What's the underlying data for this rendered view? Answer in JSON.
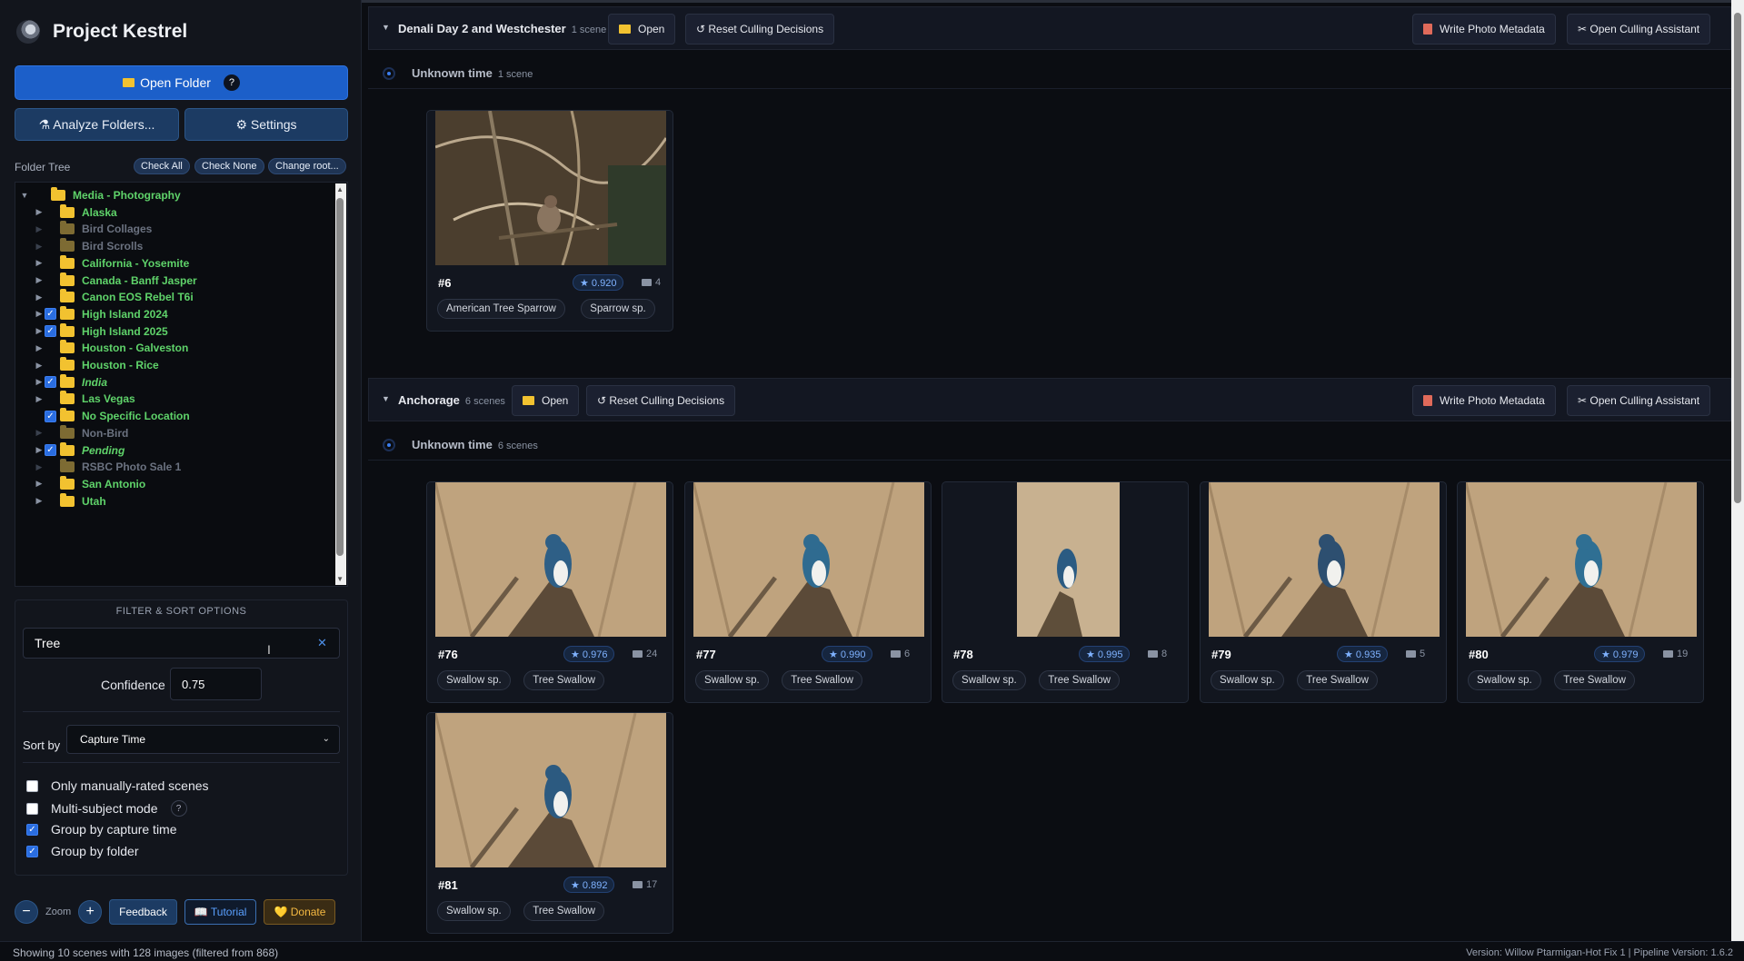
{
  "app": {
    "title": "Project Kestrel"
  },
  "sidebar": {
    "open_folder": "Open Folder",
    "help": "?",
    "analyze": "⚗ Analyze Folders...",
    "settings": "⚙ Settings",
    "tree_label": "Folder Tree",
    "check_all": "Check All",
    "check_none": "Check None",
    "change_root": "Change root..."
  },
  "tree": [
    {
      "name": "Media - Photography",
      "state": "open",
      "checked": false,
      "dim": false,
      "italic": false
    },
    {
      "name": "Alaska",
      "checked": false,
      "dim": false,
      "italic": false
    },
    {
      "name": "Bird Collages",
      "checked": false,
      "dim": true,
      "italic": false
    },
    {
      "name": "Bird Scrolls",
      "checked": false,
      "dim": true,
      "italic": false
    },
    {
      "name": "California - Yosemite",
      "checked": false,
      "dim": false,
      "italic": false
    },
    {
      "name": "Canada - Banff Jasper",
      "checked": false,
      "dim": false,
      "italic": false
    },
    {
      "name": "Canon EOS Rebel T6i",
      "checked": false,
      "dim": false,
      "italic": false
    },
    {
      "name": "High Island 2024",
      "checked": true,
      "dim": false,
      "italic": false
    },
    {
      "name": "High Island 2025",
      "checked": true,
      "dim": false,
      "italic": false
    },
    {
      "name": "Houston - Galveston",
      "checked": false,
      "dim": false,
      "italic": false
    },
    {
      "name": "Houston - Rice",
      "checked": false,
      "dim": false,
      "italic": false
    },
    {
      "name": "India",
      "checked": true,
      "dim": false,
      "italic": true
    },
    {
      "name": "Las Vegas",
      "checked": false,
      "dim": false,
      "italic": false
    },
    {
      "name": "No Specific Location",
      "checked": true,
      "dim": false,
      "italic": false
    },
    {
      "name": "Non-Bird",
      "checked": false,
      "dim": true,
      "italic": false
    },
    {
      "name": "Pending",
      "checked": true,
      "dim": false,
      "italic": true
    },
    {
      "name": "RSBC Photo Sale 1",
      "checked": false,
      "dim": true,
      "italic": false
    },
    {
      "name": "San Antonio",
      "checked": false,
      "dim": false,
      "italic": false
    },
    {
      "name": "Utah",
      "checked": false,
      "dim": false,
      "italic": false
    }
  ],
  "filter": {
    "title": "FILTER & SORT OPTIONS",
    "search_value": "Tree",
    "clear": "✕",
    "confidence_label": "Confidence",
    "confidence_value": "0.75",
    "sort_label": "Sort by",
    "sort_value": "Capture Time",
    "options": [
      {
        "label": "Only manually-rated scenes",
        "checked": false
      },
      {
        "label": "Multi-subject mode",
        "checked": false
      },
      {
        "label": "Group by capture time",
        "checked": true
      },
      {
        "label": "Group by folder",
        "checked": true
      }
    ],
    "multi_help": "?"
  },
  "bottom": {
    "zoom_minus": "−",
    "zoom_label": "Zoom",
    "zoom_plus": "+",
    "feedback": "Feedback",
    "tutorial": "📖 Tutorial",
    "donate": "💛 Donate"
  },
  "status": {
    "left": "Showing 10 scenes with 128 images (filtered from 868)",
    "right": "Version: Willow Ptarmigan-Hot Fix 1 | Pipeline Version: 1.6.2"
  },
  "groups": [
    {
      "title": "Denali Day 2 and Westchester",
      "count": "1 scene",
      "open": "Open",
      "reset": "↺ Reset Culling Decisions",
      "write": "Write Photo Metadata",
      "assistant": "✂ Open Culling Assistant",
      "time_label": "Unknown time",
      "time_count": "1 scene"
    },
    {
      "title": "Anchorage",
      "count": "6 scenes",
      "open": "Open",
      "reset": "↺ Reset Culling Decisions",
      "write": "Write Photo Metadata",
      "assistant": "✂ Open Culling Assistant",
      "time_label": "Unknown time",
      "time_count": "6 scenes"
    }
  ],
  "cards": [
    {
      "num": "#6",
      "conf": "★ 0.920",
      "count": "4",
      "tags": [
        "American Tree Sparrow",
        "Sparrow sp."
      ],
      "bird_color": "#8a7560"
    },
    {
      "num": "#76",
      "conf": "★ 0.976",
      "count": "24",
      "tags": [
        "Swallow sp.",
        "Tree Swallow"
      ],
      "bird_color": "#2e5f86"
    },
    {
      "num": "#77",
      "conf": "★ 0.990",
      "count": "6",
      "tags": [
        "Swallow sp.",
        "Tree Swallow"
      ],
      "bird_color": "#2f6b90"
    },
    {
      "num": "#78",
      "conf": "★ 0.995",
      "count": "8",
      "tags": [
        "Swallow sp.",
        "Tree Swallow"
      ],
      "bird_color": "#2b5b82"
    },
    {
      "num": "#79",
      "conf": "★ 0.935",
      "count": "5",
      "tags": [
        "Swallow sp.",
        "Tree Swallow"
      ],
      "bird_color": "#2d4f70"
    },
    {
      "num": "#80",
      "conf": "★ 0.979",
      "count": "19",
      "tags": [
        "Swallow sp.",
        "Tree Swallow"
      ],
      "bird_color": "#2f6f93"
    },
    {
      "num": "#81",
      "conf": "★ 0.892",
      "count": "17",
      "tags": [
        "Swallow sp.",
        "Tree Swallow"
      ],
      "bird_color": "#2c5a80"
    }
  ]
}
